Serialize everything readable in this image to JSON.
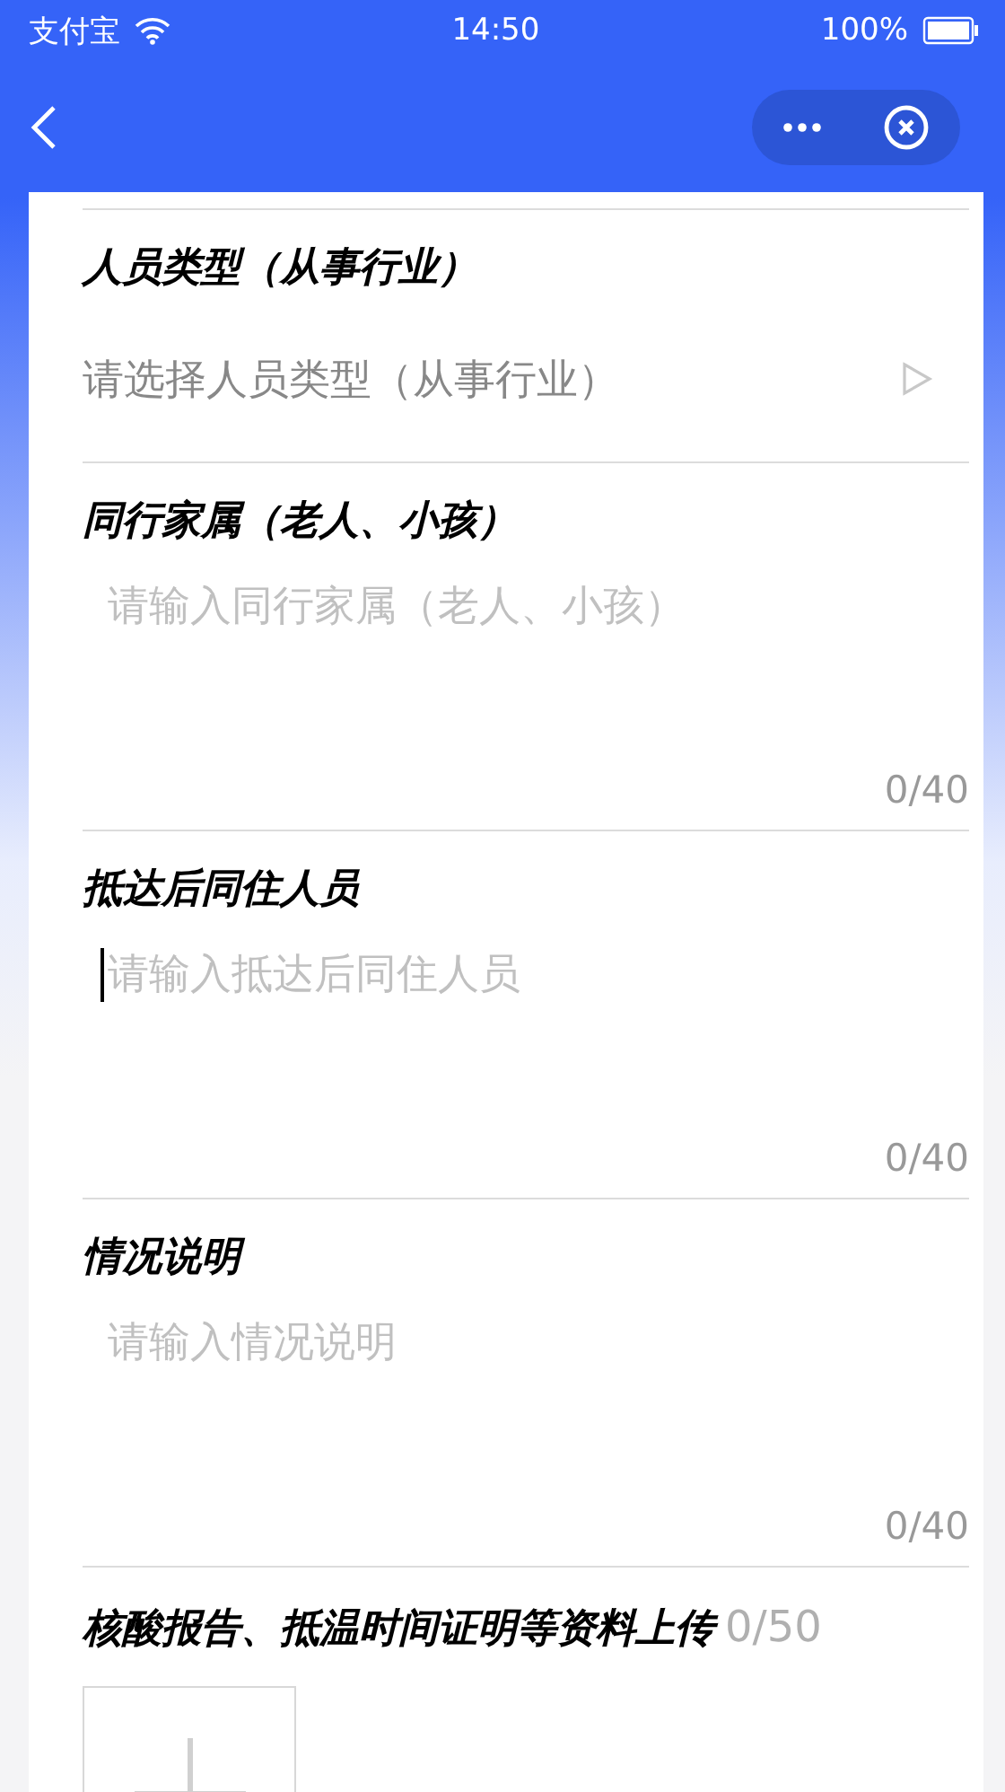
{
  "status_bar": {
    "carrier": "支付宝",
    "time": "14:50",
    "battery": "100%"
  },
  "fields": [
    {
      "kind": "select",
      "label": "人员类型（从事行业）",
      "placeholder": "请选择人员类型（从事行业）"
    },
    {
      "kind": "textarea",
      "label": "同行家属（老人、小孩）",
      "placeholder": "请输入同行家属（老人、小孩）",
      "focused": false,
      "counter": "0/40"
    },
    {
      "kind": "textarea",
      "label": "抵达后同住人员",
      "placeholder": "请输入抵达后同住人员",
      "focused": true,
      "counter": "0/40"
    },
    {
      "kind": "textarea",
      "label": "情况说明",
      "placeholder": "请输入情况说明",
      "focused": false,
      "counter": "0/40"
    },
    {
      "kind": "upload",
      "label": "核酸报告、抵温时间证明等资料上传",
      "counter": "0/50"
    }
  ]
}
